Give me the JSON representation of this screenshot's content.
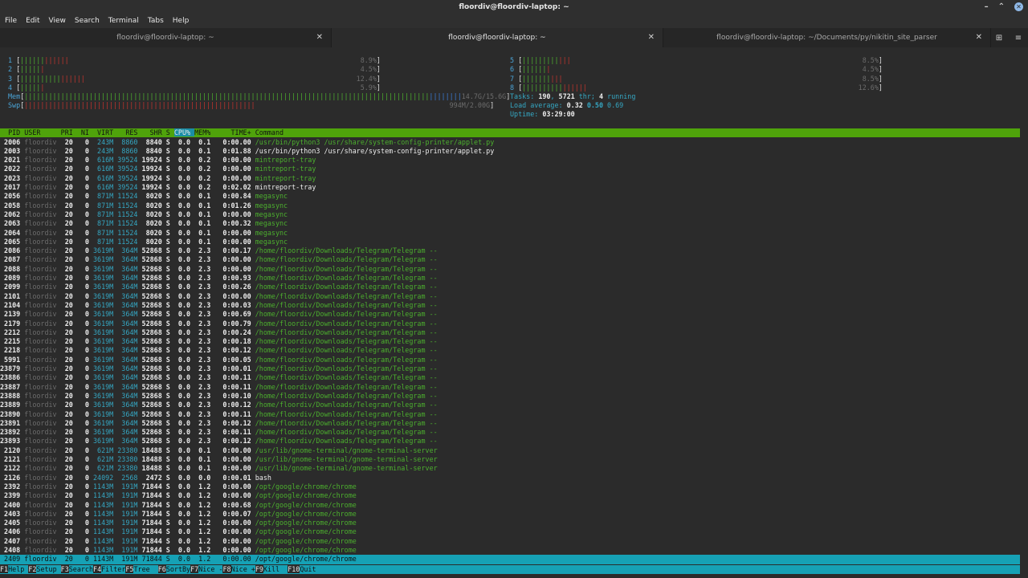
{
  "window": {
    "title": "floordiv@floordiv-laptop: ~",
    "controls": {
      "minimize": "–",
      "maximize": "⌃",
      "close": "✕"
    }
  },
  "menu": [
    "File",
    "Edit",
    "View",
    "Search",
    "Terminal",
    "Tabs",
    "Help"
  ],
  "tabs": [
    {
      "label": "floordiv@floordiv-laptop: ~",
      "active": false
    },
    {
      "label": "floordiv@floordiv-laptop: ~",
      "active": true
    },
    {
      "label": "floordiv@floordiv-laptop: ~/Documents/py/nikitin_site_parser",
      "active": false
    }
  ],
  "tab_close_glyph": "✕",
  "new_tab_glyph": "⊞",
  "menu_glyph": "≡",
  "htop": {
    "cpus_left": [
      {
        "n": "1",
        "pct": "8.9%",
        "green": 6,
        "red": 6
      },
      {
        "n": "2",
        "pct": "4.5%",
        "green": 5,
        "red": 1
      },
      {
        "n": "3",
        "pct": "12.4%",
        "green": 10,
        "red": 6
      },
      {
        "n": "4",
        "pct": "5.9%",
        "green": 5,
        "red": 1
      }
    ],
    "cpus_right": [
      {
        "n": "5",
        "pct": "8.5%",
        "green": 9,
        "red": 3
      },
      {
        "n": "6",
        "pct": "4.5%",
        "green": 6,
        "red": 1
      },
      {
        "n": "7",
        "pct": "8.5%",
        "green": 7,
        "red": 3
      },
      {
        "n": "8",
        "pct": "12.6%",
        "green": 10,
        "red": 6
      }
    ],
    "mem": {
      "label": "Mem",
      "used": "14.7G",
      "total": "15.6G"
    },
    "swp": {
      "label": "Swp",
      "used": "994M",
      "total": "2.00G"
    },
    "tasks": {
      "label": "Tasks:",
      "count": "190",
      "thr_count": "5721",
      "thr_label": "thr;",
      "running": "4",
      "running_label": "running"
    },
    "load": {
      "label": "Load average:",
      "v1": "0.32",
      "v2": "0.50",
      "v3": "0.69"
    },
    "uptime": {
      "label": "Uptime:",
      "value": "03:29:00"
    },
    "columns": [
      "PID",
      "USER",
      "PRI",
      "NI",
      "VIRT",
      "RES",
      "SHR",
      "S",
      "CPU%",
      "MEM%",
      "TIME+",
      "Command"
    ],
    "processes": [
      [
        "2006",
        "floordiv",
        "20",
        "0",
        "243M",
        "8860",
        "8840",
        "S",
        "0.0",
        "0.1",
        "0:00.00",
        "/usr/bin/python3 /usr/share/system-config-printer/applet.py",
        "g"
      ],
      [
        "2003",
        "floordiv",
        "20",
        "0",
        "243M",
        "8860",
        "8840",
        "S",
        "0.0",
        "0.1",
        "0:01.88",
        "/usr/bin/python3 /usr/share/system-config-printer/applet.py",
        "w"
      ],
      [
        "2021",
        "floordiv",
        "20",
        "0",
        "616M",
        "39524",
        "19924",
        "S",
        "0.0",
        "0.2",
        "0:00.00",
        "mintreport-tray",
        "g"
      ],
      [
        "2022",
        "floordiv",
        "20",
        "0",
        "616M",
        "39524",
        "19924",
        "S",
        "0.0",
        "0.2",
        "0:00.00",
        "mintreport-tray",
        "g"
      ],
      [
        "2023",
        "floordiv",
        "20",
        "0",
        "616M",
        "39524",
        "19924",
        "S",
        "0.0",
        "0.2",
        "0:00.00",
        "mintreport-tray",
        "g"
      ],
      [
        "2017",
        "floordiv",
        "20",
        "0",
        "616M",
        "39524",
        "19924",
        "S",
        "0.0",
        "0.2",
        "0:02.02",
        "mintreport-tray",
        "w"
      ],
      [
        "2056",
        "floordiv",
        "20",
        "0",
        "871M",
        "11524",
        "8020",
        "S",
        "0.0",
        "0.1",
        "0:00.84",
        "megasync",
        "g"
      ],
      [
        "2058",
        "floordiv",
        "20",
        "0",
        "871M",
        "11524",
        "8020",
        "S",
        "0.0",
        "0.1",
        "0:01.26",
        "megasync",
        "g"
      ],
      [
        "2062",
        "floordiv",
        "20",
        "0",
        "871M",
        "11524",
        "8020",
        "S",
        "0.0",
        "0.1",
        "0:00.00",
        "megasync",
        "g"
      ],
      [
        "2063",
        "floordiv",
        "20",
        "0",
        "871M",
        "11524",
        "8020",
        "S",
        "0.0",
        "0.1",
        "0:00.32",
        "megasync",
        "g"
      ],
      [
        "2064",
        "floordiv",
        "20",
        "0",
        "871M",
        "11524",
        "8020",
        "S",
        "0.0",
        "0.1",
        "0:00.00",
        "megasync",
        "g"
      ],
      [
        "2065",
        "floordiv",
        "20",
        "0",
        "871M",
        "11524",
        "8020",
        "S",
        "0.0",
        "0.1",
        "0:00.00",
        "megasync",
        "g"
      ],
      [
        "2086",
        "floordiv",
        "20",
        "0",
        "3619M",
        "364M",
        "52868",
        "S",
        "0.0",
        "2.3",
        "0:00.17",
        "/home/floordiv/Downloads/Telegram/Telegram --",
        "g"
      ],
      [
        "2087",
        "floordiv",
        "20",
        "0",
        "3619M",
        "364M",
        "52868",
        "S",
        "0.0",
        "2.3",
        "0:00.00",
        "/home/floordiv/Downloads/Telegram/Telegram --",
        "g"
      ],
      [
        "2088",
        "floordiv",
        "20",
        "0",
        "3619M",
        "364M",
        "52868",
        "S",
        "0.0",
        "2.3",
        "0:00.00",
        "/home/floordiv/Downloads/Telegram/Telegram --",
        "g"
      ],
      [
        "2089",
        "floordiv",
        "20",
        "0",
        "3619M",
        "364M",
        "52868",
        "S",
        "0.0",
        "2.3",
        "0:00.93",
        "/home/floordiv/Downloads/Telegram/Telegram --",
        "g"
      ],
      [
        "2099",
        "floordiv",
        "20",
        "0",
        "3619M",
        "364M",
        "52868",
        "S",
        "0.0",
        "2.3",
        "0:00.26",
        "/home/floordiv/Downloads/Telegram/Telegram --",
        "g"
      ],
      [
        "2101",
        "floordiv",
        "20",
        "0",
        "3619M",
        "364M",
        "52868",
        "S",
        "0.0",
        "2.3",
        "0:00.00",
        "/home/floordiv/Downloads/Telegram/Telegram --",
        "g"
      ],
      [
        "2104",
        "floordiv",
        "20",
        "0",
        "3619M",
        "364M",
        "52868",
        "S",
        "0.0",
        "2.3",
        "0:00.03",
        "/home/floordiv/Downloads/Telegram/Telegram --",
        "g"
      ],
      [
        "2139",
        "floordiv",
        "20",
        "0",
        "3619M",
        "364M",
        "52868",
        "S",
        "0.0",
        "2.3",
        "0:00.69",
        "/home/floordiv/Downloads/Telegram/Telegram --",
        "g"
      ],
      [
        "2179",
        "floordiv",
        "20",
        "0",
        "3619M",
        "364M",
        "52868",
        "S",
        "0.0",
        "2.3",
        "0:00.79",
        "/home/floordiv/Downloads/Telegram/Telegram --",
        "g"
      ],
      [
        "2212",
        "floordiv",
        "20",
        "0",
        "3619M",
        "364M",
        "52868",
        "S",
        "0.0",
        "2.3",
        "0:00.24",
        "/home/floordiv/Downloads/Telegram/Telegram --",
        "g"
      ],
      [
        "2215",
        "floordiv",
        "20",
        "0",
        "3619M",
        "364M",
        "52868",
        "S",
        "0.0",
        "2.3",
        "0:00.18",
        "/home/floordiv/Downloads/Telegram/Telegram --",
        "g"
      ],
      [
        "2218",
        "floordiv",
        "20",
        "0",
        "3619M",
        "364M",
        "52868",
        "S",
        "0.0",
        "2.3",
        "0:00.12",
        "/home/floordiv/Downloads/Telegram/Telegram --",
        "g"
      ],
      [
        "5991",
        "floordiv",
        "20",
        "0",
        "3619M",
        "364M",
        "52868",
        "S",
        "0.0",
        "2.3",
        "0:00.05",
        "/home/floordiv/Downloads/Telegram/Telegram --",
        "g"
      ],
      [
        "23879",
        "floordiv",
        "20",
        "0",
        "3619M",
        "364M",
        "52868",
        "S",
        "0.0",
        "2.3",
        "0:00.01",
        "/home/floordiv/Downloads/Telegram/Telegram --",
        "g"
      ],
      [
        "23886",
        "floordiv",
        "20",
        "0",
        "3619M",
        "364M",
        "52868",
        "S",
        "0.0",
        "2.3",
        "0:00.11",
        "/home/floordiv/Downloads/Telegram/Telegram --",
        "g"
      ],
      [
        "23887",
        "floordiv",
        "20",
        "0",
        "3619M",
        "364M",
        "52868",
        "S",
        "0.0",
        "2.3",
        "0:00.11",
        "/home/floordiv/Downloads/Telegram/Telegram --",
        "g"
      ],
      [
        "23888",
        "floordiv",
        "20",
        "0",
        "3619M",
        "364M",
        "52868",
        "S",
        "0.0",
        "2.3",
        "0:00.10",
        "/home/floordiv/Downloads/Telegram/Telegram --",
        "g"
      ],
      [
        "23889",
        "floordiv",
        "20",
        "0",
        "3619M",
        "364M",
        "52868",
        "S",
        "0.0",
        "2.3",
        "0:00.12",
        "/home/floordiv/Downloads/Telegram/Telegram --",
        "g"
      ],
      [
        "23890",
        "floordiv",
        "20",
        "0",
        "3619M",
        "364M",
        "52868",
        "S",
        "0.0",
        "2.3",
        "0:00.11",
        "/home/floordiv/Downloads/Telegram/Telegram --",
        "g"
      ],
      [
        "23891",
        "floordiv",
        "20",
        "0",
        "3619M",
        "364M",
        "52868",
        "S",
        "0.0",
        "2.3",
        "0:00.12",
        "/home/floordiv/Downloads/Telegram/Telegram --",
        "g"
      ],
      [
        "23892",
        "floordiv",
        "20",
        "0",
        "3619M",
        "364M",
        "52868",
        "S",
        "0.0",
        "2.3",
        "0:00.11",
        "/home/floordiv/Downloads/Telegram/Telegram --",
        "g"
      ],
      [
        "23893",
        "floordiv",
        "20",
        "0",
        "3619M",
        "364M",
        "52868",
        "S",
        "0.0",
        "2.3",
        "0:00.12",
        "/home/floordiv/Downloads/Telegram/Telegram --",
        "g"
      ],
      [
        "2120",
        "floordiv",
        "20",
        "0",
        "621M",
        "23380",
        "18488",
        "S",
        "0.0",
        "0.1",
        "0:00.00",
        "/usr/lib/gnome-terminal/gnome-terminal-server",
        "g"
      ],
      [
        "2121",
        "floordiv",
        "20",
        "0",
        "621M",
        "23380",
        "18488",
        "S",
        "0.0",
        "0.1",
        "0:00.00",
        "/usr/lib/gnome-terminal/gnome-terminal-server",
        "g"
      ],
      [
        "2122",
        "floordiv",
        "20",
        "0",
        "621M",
        "23380",
        "18488",
        "S",
        "0.0",
        "0.1",
        "0:00.00",
        "/usr/lib/gnome-terminal/gnome-terminal-server",
        "g"
      ],
      [
        "2126",
        "floordiv",
        "20",
        "0",
        "24092",
        "2568",
        "2472",
        "S",
        "0.0",
        "0.0",
        "0:00.01",
        "bash",
        "w"
      ],
      [
        "2392",
        "floordiv",
        "20",
        "0",
        "1143M",
        "191M",
        "71844",
        "S",
        "0.0",
        "1.2",
        "0:00.00",
        "/opt/google/chrome/chrome",
        "g"
      ],
      [
        "2399",
        "floordiv",
        "20",
        "0",
        "1143M",
        "191M",
        "71844",
        "S",
        "0.0",
        "1.2",
        "0:00.00",
        "/opt/google/chrome/chrome",
        "g"
      ],
      [
        "2400",
        "floordiv",
        "20",
        "0",
        "1143M",
        "191M",
        "71844",
        "S",
        "0.0",
        "1.2",
        "0:00.68",
        "/opt/google/chrome/chrome",
        "g"
      ],
      [
        "2403",
        "floordiv",
        "20",
        "0",
        "1143M",
        "191M",
        "71844",
        "S",
        "0.0",
        "1.2",
        "0:00.07",
        "/opt/google/chrome/chrome",
        "g"
      ],
      [
        "2405",
        "floordiv",
        "20",
        "0",
        "1143M",
        "191M",
        "71844",
        "S",
        "0.0",
        "1.2",
        "0:00.00",
        "/opt/google/chrome/chrome",
        "g"
      ],
      [
        "2406",
        "floordiv",
        "20",
        "0",
        "1143M",
        "191M",
        "71844",
        "S",
        "0.0",
        "1.2",
        "0:00.00",
        "/opt/google/chrome/chrome",
        "g"
      ],
      [
        "2407",
        "floordiv",
        "20",
        "0",
        "1143M",
        "191M",
        "71844",
        "S",
        "0.0",
        "1.2",
        "0:00.00",
        "/opt/google/chrome/chrome",
        "g"
      ],
      [
        "2408",
        "floordiv",
        "20",
        "0",
        "1143M",
        "191M",
        "71844",
        "S",
        "0.0",
        "1.2",
        "0:00.00",
        "/opt/google/chrome/chrome",
        "g"
      ],
      [
        "2409",
        "floordiv",
        "20",
        "0",
        "1143M",
        "191M",
        "71844",
        "S",
        "0.0",
        "1.2",
        "0:00.00",
        "/opt/google/chrome/chrome",
        "sel"
      ]
    ],
    "fkeys": [
      {
        "key": "F1",
        "label": "Help"
      },
      {
        "key": "F2",
        "label": "Setup"
      },
      {
        "key": "F3",
        "label": "Search"
      },
      {
        "key": "F4",
        "label": "Filter"
      },
      {
        "key": "F5",
        "label": "Tree"
      },
      {
        "key": "F6",
        "label": "SortBy"
      },
      {
        "key": "F7",
        "label": "Nice -"
      },
      {
        "key": "F8",
        "label": "Nice +"
      },
      {
        "key": "F9",
        "label": "Kill"
      },
      {
        "key": "F10",
        "label": "Quit"
      }
    ]
  },
  "colors": {
    "header_bg": "#4fa30b",
    "selection_bg": "#16a1b5",
    "bar_green": "#4caf2e",
    "bar_red": "#c4342d",
    "num_blue": "#4aa3d6"
  }
}
